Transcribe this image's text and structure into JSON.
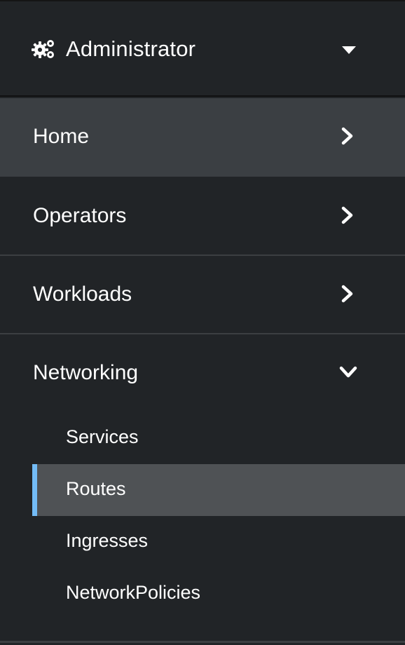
{
  "perspective": {
    "icon": "cogs-icon",
    "label": "Administrator",
    "caret_icon": "caret-down-icon"
  },
  "sections": [
    {
      "label": "Home",
      "icon": "angle-right-icon",
      "expanded": false,
      "highlighted": true
    },
    {
      "label": "Operators",
      "icon": "angle-right-icon",
      "expanded": false
    },
    {
      "label": "Workloads",
      "icon": "angle-right-icon",
      "expanded": false
    },
    {
      "label": "Networking",
      "icon": "angle-down-icon",
      "expanded": true
    }
  ],
  "networking_items": [
    {
      "label": "Services",
      "active": false
    },
    {
      "label": "Routes",
      "active": true
    },
    {
      "label": "Ingresses",
      "active": false
    },
    {
      "label": "NetworkPolicies",
      "active": false
    }
  ],
  "colors": {
    "background": "#212427",
    "hover": "#3b3f43",
    "active_item": "#4f5255",
    "active_accent": "#73bcf7",
    "text": "#ffffff"
  }
}
